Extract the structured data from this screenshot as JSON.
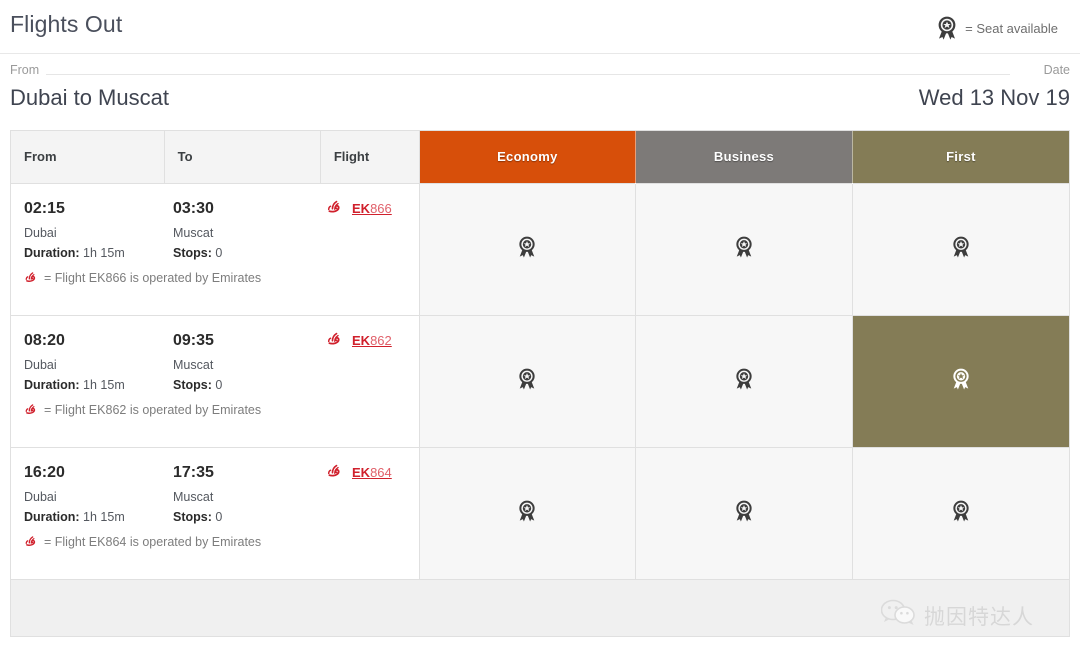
{
  "header": {
    "title": "Flights Out",
    "legend_text": "= Seat available",
    "legend_icon": "rosette-seat-icon"
  },
  "route": {
    "from_label": "From",
    "from_value": "Dubai to Muscat",
    "date_label": "Date",
    "date_value": "Wed 13 Nov 19"
  },
  "colors": {
    "economy": "#d74f0a",
    "business": "#7d7a78",
    "first": "#847c56",
    "first_selected": "#847c56",
    "link_red": "#d0202c",
    "row_cabin_bg": "#f7f7f7"
  },
  "table": {
    "columns": [
      {
        "key": "from",
        "label": "From"
      },
      {
        "key": "to",
        "label": "To"
      },
      {
        "key": "flight",
        "label": "Flight"
      },
      {
        "key": "economy",
        "label": "Economy"
      },
      {
        "key": "business",
        "label": "Business"
      },
      {
        "key": "first",
        "label": "First"
      }
    ],
    "rows": [
      {
        "dep_time": "02:15",
        "dep_city": "Dubai",
        "duration_label": "Duration:",
        "duration_value": "1h 15m",
        "arr_time": "03:30",
        "arr_city": "Muscat",
        "stops_label": "Stops:",
        "stops_value": "0",
        "flight_prefix": "EK",
        "flight_number": "866",
        "flight_code": "EK866",
        "airline_icon": "emirates-logo-icon",
        "operated_note": "= Flight EK866 is operated by Emirates",
        "cabins": [
          {
            "class": "Economy",
            "available": true,
            "selected": false,
            "icon": "rosette-seat-icon"
          },
          {
            "class": "Business",
            "available": true,
            "selected": false,
            "icon": "rosette-seat-icon"
          },
          {
            "class": "First",
            "available": true,
            "selected": false,
            "icon": "rosette-seat-icon"
          }
        ]
      },
      {
        "dep_time": "08:20",
        "dep_city": "Dubai",
        "duration_label": "Duration:",
        "duration_value": "1h 15m",
        "arr_time": "09:35",
        "arr_city": "Muscat",
        "stops_label": "Stops:",
        "stops_value": "0",
        "flight_prefix": "EK",
        "flight_number": "862",
        "flight_code": "EK862",
        "airline_icon": "emirates-logo-icon",
        "operated_note": "= Flight EK862 is operated by Emirates",
        "cabins": [
          {
            "class": "Economy",
            "available": true,
            "selected": false,
            "icon": "rosette-seat-icon"
          },
          {
            "class": "Business",
            "available": true,
            "selected": false,
            "icon": "rosette-seat-icon"
          },
          {
            "class": "First",
            "available": true,
            "selected": true,
            "icon": "rosette-seat-icon"
          }
        ]
      },
      {
        "dep_time": "16:20",
        "dep_city": "Dubai",
        "duration_label": "Duration:",
        "duration_value": "1h 15m",
        "arr_time": "17:35",
        "arr_city": "Muscat",
        "stops_label": "Stops:",
        "stops_value": "0",
        "flight_prefix": "EK",
        "flight_number": "864",
        "flight_code": "EK864",
        "airline_icon": "emirates-logo-icon",
        "operated_note": "= Flight EK864 is operated by Emirates",
        "cabins": [
          {
            "class": "Economy",
            "available": true,
            "selected": false,
            "icon": "rosette-seat-icon"
          },
          {
            "class": "Business",
            "available": true,
            "selected": false,
            "icon": "rosette-seat-icon"
          },
          {
            "class": "First",
            "available": true,
            "selected": false,
            "icon": "rosette-seat-icon"
          }
        ]
      }
    ]
  },
  "watermark": {
    "icon": "wechat-icon",
    "text": "抛因特达人"
  }
}
